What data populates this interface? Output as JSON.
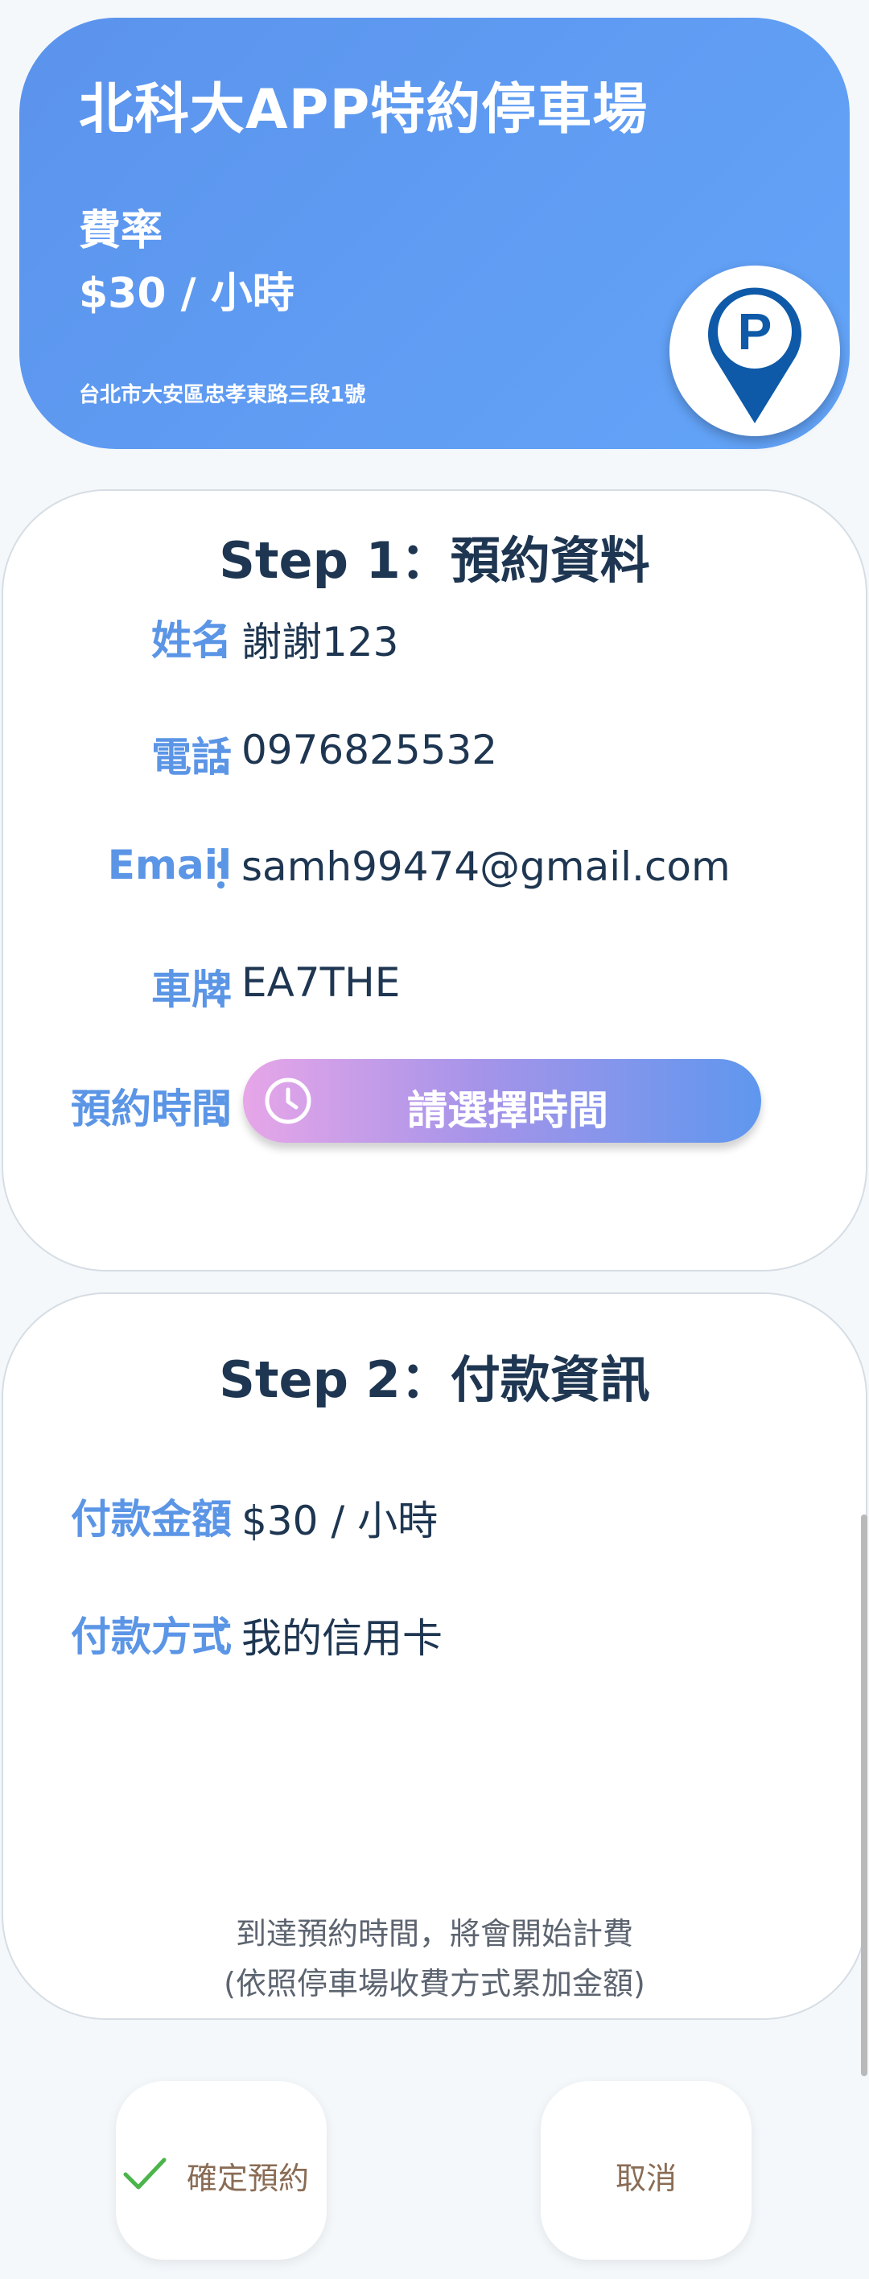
{
  "header": {
    "title": "北科大APP特約停車場",
    "rate_label": "費率",
    "rate_value": "$30 / 小時",
    "address": "台北市大安區忠孝東路三段1號",
    "logo_letter": "P",
    "logo_icon": "parking-pin-icon"
  },
  "step1": {
    "title": "Step 1：預約資料",
    "fields": [
      {
        "label": "姓名",
        "colon": "：",
        "value": "謝謝123"
      },
      {
        "label": "電話",
        "colon": "：",
        "value": "0976825532"
      },
      {
        "label": "Email",
        "colon": "：",
        "value": "samh99474@gmail.com"
      },
      {
        "label": "車牌",
        "colon": "：",
        "value": "EA7THE"
      }
    ],
    "time_label": "預約時間",
    "time_colon": "：",
    "time_button": "請選擇時間",
    "time_icon": "clock-icon"
  },
  "step2": {
    "title": "Step 2：付款資訊",
    "fields": [
      {
        "label": "付款金額",
        "colon": "：",
        "value": "$30 / 小時"
      },
      {
        "label": "付款方式",
        "colon": "：",
        "value": "我的信用卡"
      }
    ],
    "notice_line1": "到達預約時間，將會開始計費",
    "notice_line2": "(依照停車場收費方式累加金額)"
  },
  "actions": {
    "confirm": "確定預約",
    "confirm_icon": "checkmark-icon",
    "cancel": "取消"
  },
  "colors": {
    "header_bg": "#5b93ec",
    "label": "#5b95e6",
    "text": "#1e3651",
    "check": "#4bb54b",
    "action_text": "#8a6c55"
  }
}
